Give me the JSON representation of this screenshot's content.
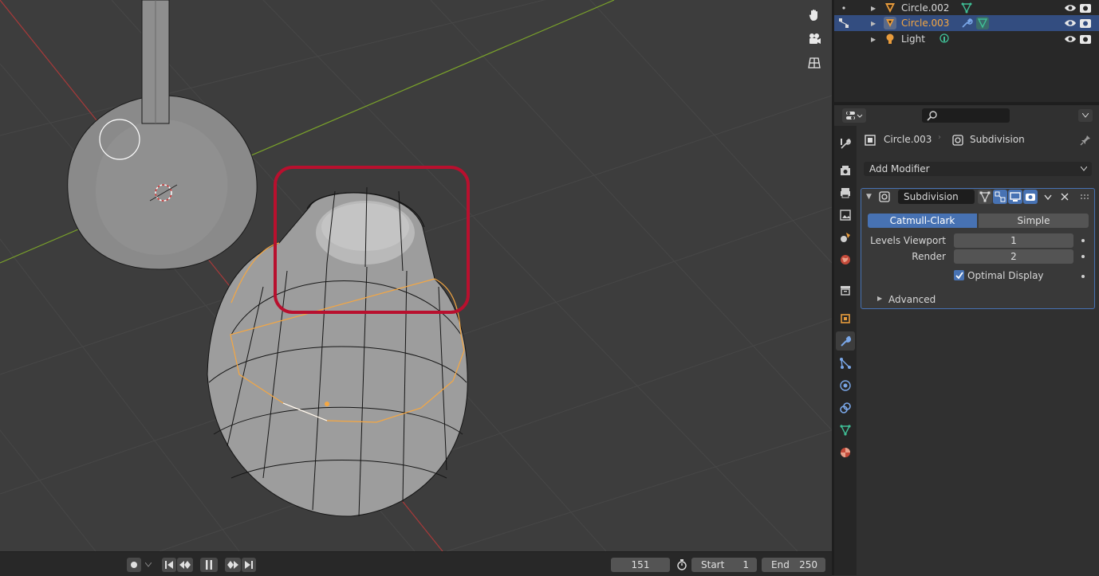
{
  "outliner": {
    "rows": [
      {
        "name": "Circle.002",
        "selected": false
      },
      {
        "name": "Circle.003",
        "selected": true
      },
      {
        "name": "Light",
        "selected": false
      }
    ]
  },
  "properties": {
    "breadcrumb_object": "Circle.003",
    "breadcrumb_modifier": "Subdivision",
    "add_modifier_label": "Add Modifier",
    "modifier": {
      "name": "Subdivision",
      "algorithms": [
        "Catmull-Clark",
        "Simple"
      ],
      "selected_algorithm": "Catmull-Clark",
      "levels_viewport_label": "Levels Viewport",
      "levels_viewport_value": "1",
      "render_label": "Render",
      "render_value": "2",
      "optimal_display_label": "Optimal Display",
      "optimal_display_checked": true,
      "advanced_label": "Advanced"
    }
  },
  "timeline": {
    "current_frame": "151",
    "start_label": "Start",
    "start_value": "1",
    "end_label": "End",
    "end_value": "250"
  },
  "colors": {
    "accent_blue": "#4772b3",
    "selection_orange": "#f5a742",
    "highlight_red": "#b8102e",
    "axis_red": "#a83a3a",
    "axis_green": "#7aa22a",
    "mesh_icon_green": "#3fbf96"
  }
}
